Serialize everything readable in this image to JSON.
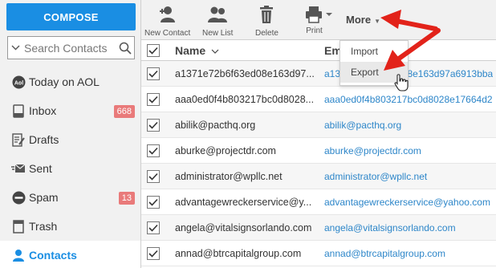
{
  "sidebar": {
    "compose_label": "COMPOSE",
    "search_placeholder": "Search Contacts",
    "items": [
      {
        "label": "Today on AOL",
        "icon": "aol-icon"
      },
      {
        "label": "Inbox",
        "icon": "inbox-icon",
        "badge": "668"
      },
      {
        "label": "Drafts",
        "icon": "drafts-icon"
      },
      {
        "label": "Sent",
        "icon": "sent-icon"
      },
      {
        "label": "Spam",
        "icon": "spam-icon",
        "badge": "13"
      },
      {
        "label": "Trash",
        "icon": "trash-icon"
      },
      {
        "label": "Contacts",
        "icon": "contacts-icon",
        "active": true
      }
    ]
  },
  "toolbar": {
    "new_contact": "New Contact",
    "new_list": "New List",
    "delete": "Delete",
    "print": "Print",
    "more": "More"
  },
  "more_menu": {
    "items": [
      "Import",
      "Export"
    ],
    "hovered": "Export"
  },
  "table": {
    "headers": {
      "name": "Name",
      "email": "Em"
    },
    "rows": [
      {
        "name": "a1371e72b6f63ed08e163d97...",
        "email": "a1371e72b6f63ed08e163d97a6913bba@"
      },
      {
        "name": "aaa0ed0f4b803217bc0d8028...",
        "email": "aaa0ed0f4b803217bc0d8028e17664d2@"
      },
      {
        "name": "abilik@pacthq.org",
        "email": "abilik@pacthq.org"
      },
      {
        "name": "aburke@projectdr.com",
        "email": "aburke@projectdr.com"
      },
      {
        "name": "administrator@wpllc.net",
        "email": "administrator@wpllc.net"
      },
      {
        "name": "advantagewreckerservice@y...",
        "email": "advantagewreckerservice@yahoo.com"
      },
      {
        "name": "angela@vitalsignsorlando.com",
        "email": "angela@vitalsignsorlando.com"
      },
      {
        "name": "annad@btrcapitalgroup.com",
        "email": "annad@btrcapitalgroup.com"
      }
    ]
  },
  "colors": {
    "accent": "#1a8ee3",
    "badge": "#e97a7a",
    "link": "#2d86c9",
    "annotation_arrow": "#e2231a"
  }
}
